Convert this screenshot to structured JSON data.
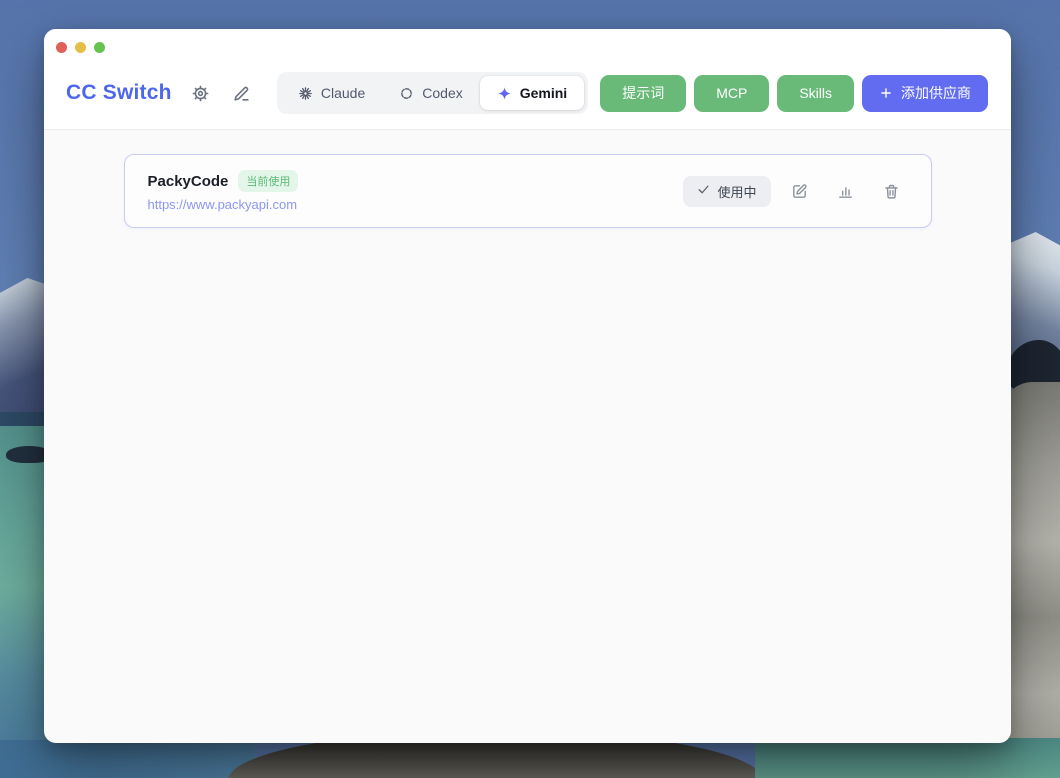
{
  "header": {
    "title": "CC Switch",
    "tabs": [
      {
        "label": "Claude",
        "icon": "claude-icon",
        "active": false
      },
      {
        "label": "Codex",
        "icon": "codex-icon",
        "active": false
      },
      {
        "label": "Gemini",
        "icon": "gemini-icon",
        "active": true
      }
    ],
    "action_buttons": [
      {
        "label": "提示词"
      },
      {
        "label": "MCP"
      },
      {
        "label": "Skills"
      }
    ],
    "add_provider_button": {
      "label": "添加供应商",
      "icon": "plus-icon"
    }
  },
  "providers": [
    {
      "name": "PackyCode",
      "badge": "当前使用",
      "url": "https://www.packyapi.com",
      "status_label": "使用中",
      "actions": [
        "edit",
        "stats",
        "delete"
      ]
    }
  ],
  "colors": {
    "accent_blue": "#4D68EA",
    "button_green": "#69BA78",
    "button_indigo": "#616CF0",
    "badge_green_bg": "#E4F6EA",
    "badge_green_text": "#5CB876",
    "url_text": "#8C96F0",
    "active_tab_icon": "#6366F1"
  }
}
